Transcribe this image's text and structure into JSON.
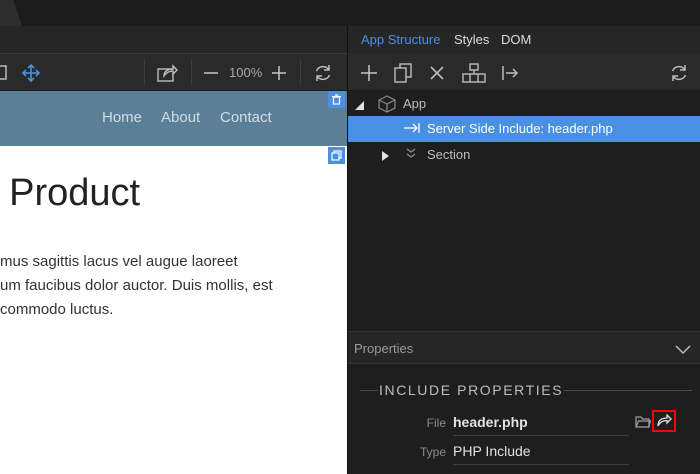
{
  "app_structure_tabs": [
    {
      "label": "App Structure",
      "active": true
    },
    {
      "label": "Styles",
      "active": false
    },
    {
      "label": "DOM",
      "active": false
    }
  ],
  "design_toolbar": {
    "zoom": "100%",
    "icons": [
      "select-icon",
      "move-icon",
      "share-icon",
      "zoom-out-icon",
      "zoom-in-icon",
      "refresh-icon"
    ]
  },
  "preview": {
    "nav_links": [
      "Home",
      "About",
      "Contact"
    ],
    "headline": "Product",
    "headline_prefix_glyph": "ı",
    "paragraph_lines": [
      "mus sagittis lacus vel augue laoreet",
      "um faucibus dolor auctor. Duis mollis, est",
      "commodo luctus."
    ]
  },
  "structure_toolbar": {
    "icons": [
      "add-icon",
      "duplicate-icon",
      "delete-icon",
      "group-icon",
      "move-out-icon",
      "refresh-icon"
    ]
  },
  "tree": [
    {
      "label": "App",
      "icon": "cube-icon",
      "expanded": true,
      "selected": false
    },
    {
      "label": "Server Side Include: header.php",
      "icon": "include-arrow-icon",
      "expanded": false,
      "selected": true
    },
    {
      "label": "Section",
      "icon": "section-chevrons-icon",
      "expanded": false,
      "selected": false
    }
  ],
  "properties": {
    "header": "Properties",
    "section_title": "INCLUDE PROPERTIES",
    "rows": [
      {
        "key": "File",
        "value": "header.php"
      },
      {
        "key": "Type",
        "value": "PHP Include"
      }
    ]
  },
  "colors": {
    "accent": "#4a90e2",
    "navbar": "#5b7f97",
    "panel_bg": "#1e1e1e",
    "highlight_border": "#ff0000"
  }
}
